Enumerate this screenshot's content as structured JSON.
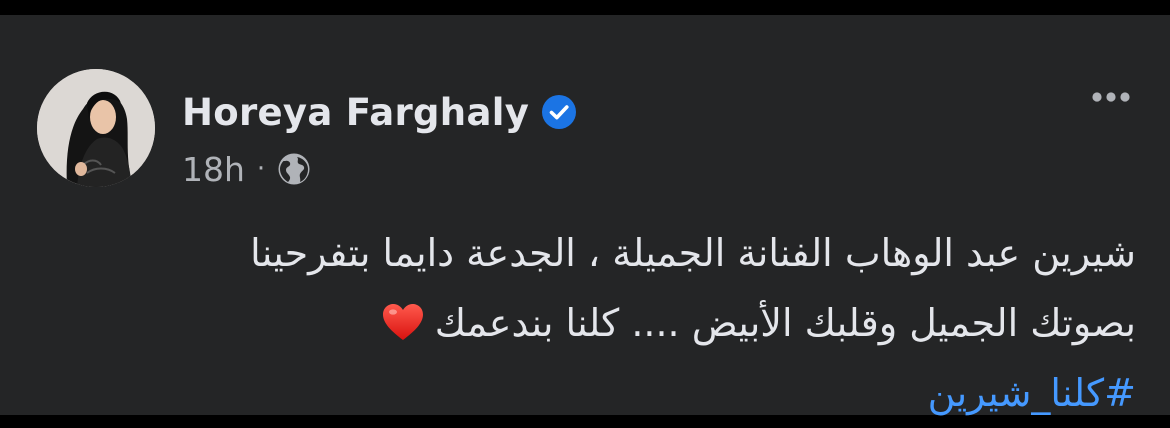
{
  "post": {
    "author_name": "Horeya Farghaly",
    "time": "18h",
    "separator": "·",
    "verified_icon": "verified-badge-icon",
    "audience_icon": "globe-icon",
    "more_icon": "more-options-icon",
    "text_line_1": "شيرين عبد الوهاب الفنانة الجميلة ، الجدعة  دايما بتفرحينا",
    "text_line_2": "بصوتك الجميل وقلبك الأبيض .... كلنا بندعمك",
    "emoji": "heart-icon",
    "hashtag": "#كلنا_شيرين"
  },
  "colors": {
    "background": "#000000",
    "card": "#242526",
    "primary_text": "#e4e6eb",
    "secondary_text": "#b0b3b8",
    "link": "#4599ff",
    "verified": "#1b74e4",
    "heart": "#e0201f"
  }
}
